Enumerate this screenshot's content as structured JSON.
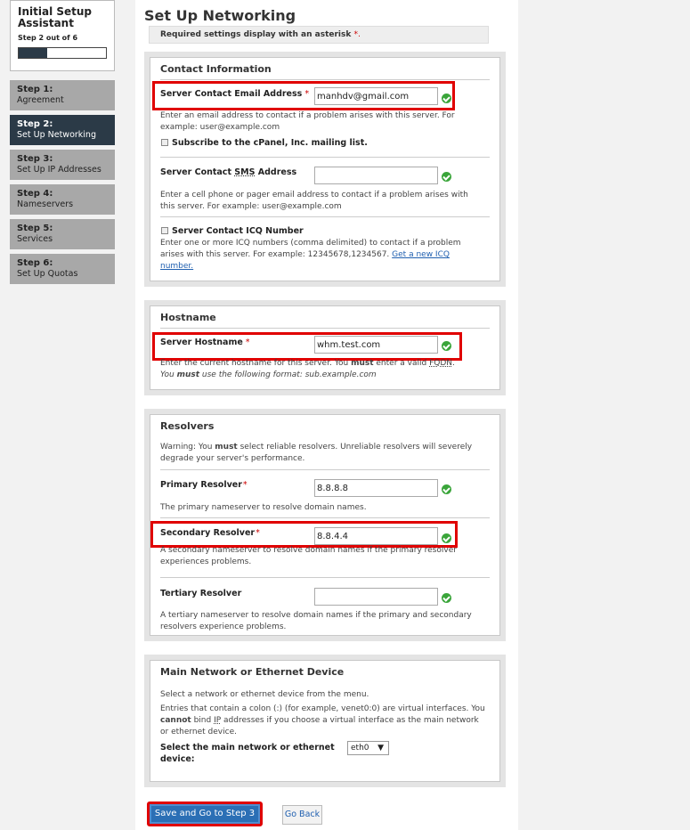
{
  "sidebar": {
    "wizard_title": "Initial Setup Assistant",
    "wizard_step": "Step 2 out of 6",
    "progress": 0.33,
    "steps": [
      {
        "num": "Step 1:",
        "name": "Agreement"
      },
      {
        "num": "Step 2:",
        "name": "Set Up Networking"
      },
      {
        "num": "Step 3:",
        "name": "Set Up IP Addresses"
      },
      {
        "num": "Step 4:",
        "name": "Nameservers"
      },
      {
        "num": "Step 5:",
        "name": "Services"
      },
      {
        "num": "Step 6:",
        "name": "Set Up Quotas"
      }
    ]
  },
  "page": {
    "title": "Set Up Networking",
    "notice": "Required settings display with an asterisk",
    "asterisk": "*."
  },
  "contact": {
    "title": "Contact Information",
    "email_label": "Server Contact Email Address",
    "email_value": "manhdv@gmail.com",
    "email_help": "Enter an email address to contact if a problem arises with this server. For example: user@example.com",
    "subscribe_label": "Subscribe to the cPanel, Inc. mailing list.",
    "sms_label_pre": "Server Contact ",
    "sms_label_abbr": "SMS",
    "sms_label_post": " Address",
    "sms_value": "",
    "sms_help": "Enter a cell phone or pager email address to contact if a problem arises with this server. For example: user@example.com",
    "icq_label": "Server Contact ICQ Number",
    "icq_help": "Enter one or more ICQ numbers (comma delimited) to contact if a problem arises with this server. For example: 12345678,1234567.",
    "icq_link": "Get a new ICQ number."
  },
  "hostname": {
    "title": "Hostname",
    "label": "Server Hostname",
    "value": "whm.test.com",
    "help_pre": "Enter the current hostname for this server. You ",
    "help_must": "must",
    "help_mid": " enter a valid ",
    "help_fqdn": "FQDN",
    "help_end": ".",
    "help2_pre": "You ",
    "help2_must": "must",
    "help2_post": " use the following format: sub.example.com"
  },
  "resolvers": {
    "title": "Resolvers",
    "warning_pre": "Warning: You ",
    "warning_must": "must",
    "warning_post": " select reliable resolvers. Unreliable resolvers will severely degrade your server's performance.",
    "primary_label": "Primary Resolver",
    "primary_value": "8.8.8.8",
    "primary_help": "The primary nameserver to resolve domain names.",
    "secondary_label": "Secondary Resolver",
    "secondary_value": "8.8.4.4",
    "secondary_help": "A secondary nameserver to resolve domain names if the primary resolver experiences problems.",
    "tertiary_label": "Tertiary Resolver",
    "tertiary_value": "",
    "tertiary_help": "A tertiary nameserver to resolve domain names if the primary and secondary resolvers experience problems."
  },
  "network": {
    "title": "Main Network or Ethernet Device",
    "help1": "Select a network or ethernet device from the menu.",
    "help2_pre": "Entries that contain a colon (:) (for example, venet0:0) are virtual interfaces. You ",
    "help2_cannot": "cannot",
    "help2_mid": " bind ",
    "help2_ip": "IP",
    "help2_post": " addresses if you choose a virtual interface as the main network or ethernet device.",
    "select_label": "Select the main network or ethernet device:",
    "select_value": "eth0"
  },
  "actions": {
    "save_label": "Save and Go to Step 3",
    "back_label": "Go Back"
  },
  "asterisk": "*",
  "colors": {
    "accent": "#2b3a47",
    "highlight": "#e00000",
    "ok": "#3aa53a",
    "button": "#2b6fb5"
  }
}
